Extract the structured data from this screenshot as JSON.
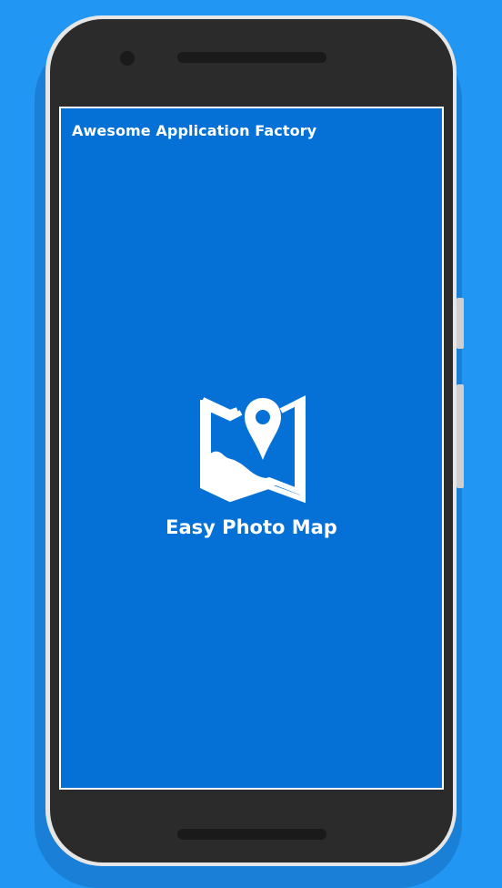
{
  "splash": {
    "company_name": "Awesome Application Factory",
    "app_name": "Easy Photo Map",
    "logo_icon": "photo-map-pin-icon"
  },
  "colors": {
    "background": "#2196f3",
    "screen": "#0571d6",
    "device": "#2b2b2b",
    "text": "#ffffff"
  }
}
